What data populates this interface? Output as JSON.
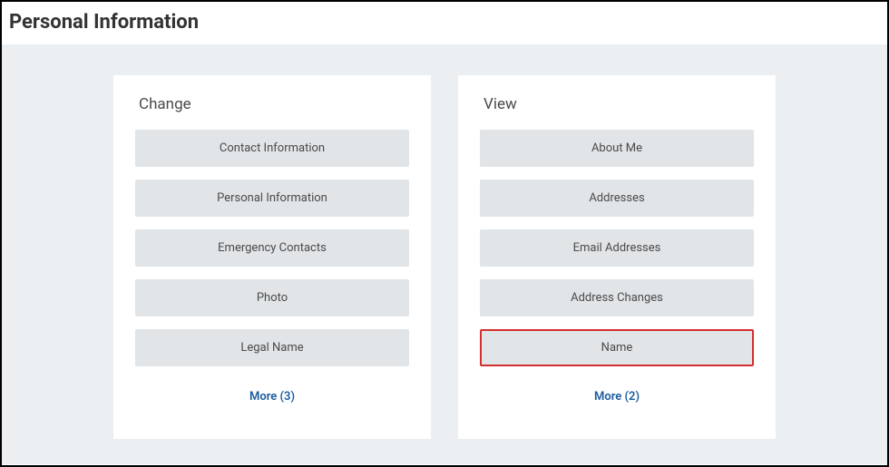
{
  "page": {
    "title": "Personal Information"
  },
  "cards": [
    {
      "title": "Change",
      "items": [
        {
          "label": "Contact Information",
          "highlighted": false
        },
        {
          "label": "Personal Information",
          "highlighted": false
        },
        {
          "label": "Emergency Contacts",
          "highlighted": false
        },
        {
          "label": "Photo",
          "highlighted": false
        },
        {
          "label": "Legal Name",
          "highlighted": false
        }
      ],
      "more_label": "More (3)"
    },
    {
      "title": "View",
      "items": [
        {
          "label": "About Me",
          "highlighted": false
        },
        {
          "label": "Addresses",
          "highlighted": false
        },
        {
          "label": "Email Addresses",
          "highlighted": false
        },
        {
          "label": "Address Changes",
          "highlighted": false
        },
        {
          "label": "Name",
          "highlighted": true
        }
      ],
      "more_label": "More (2)"
    }
  ]
}
